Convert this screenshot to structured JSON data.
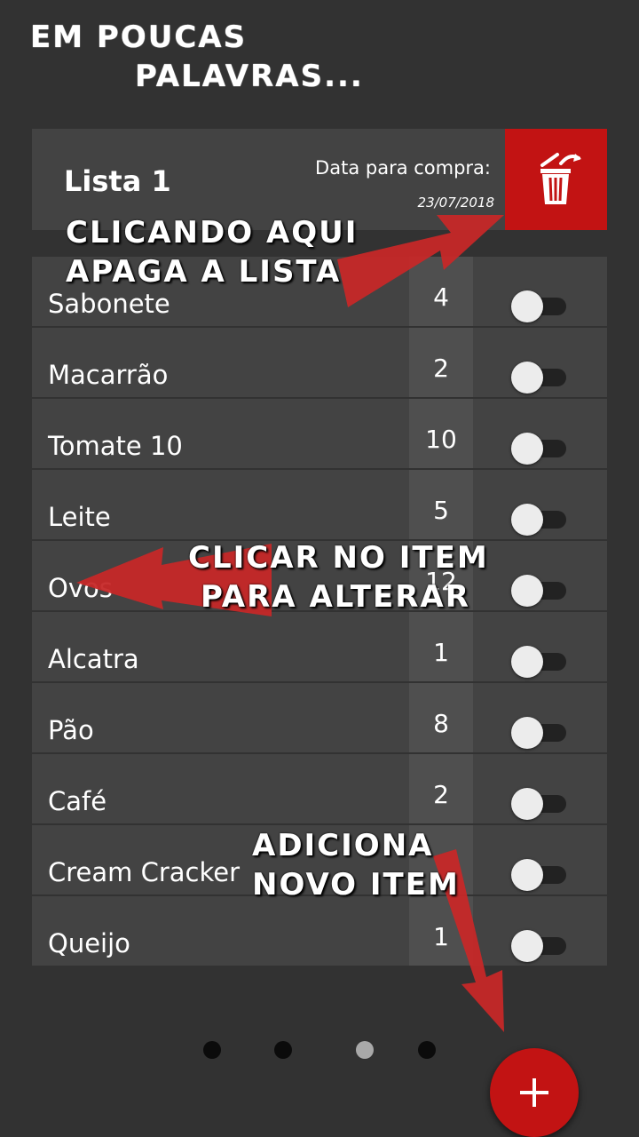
{
  "headline": {
    "line1": "EM POUCAS",
    "line2": "PALAVRAS..."
  },
  "list": {
    "title": "Lista 1",
    "date_label": "Data para compra:",
    "date_value": "23/07/2018"
  },
  "items": [
    {
      "name": "Sabonete",
      "qty": "4"
    },
    {
      "name": "Macarrão",
      "qty": "2"
    },
    {
      "name": "Tomate 10",
      "qty": "10"
    },
    {
      "name": "Leite",
      "qty": "5"
    },
    {
      "name": "Ovos",
      "qty": "12"
    },
    {
      "name": "Alcatra",
      "qty": "1"
    },
    {
      "name": "Pão",
      "qty": "8"
    },
    {
      "name": "Café",
      "qty": "2"
    },
    {
      "name": "Cream Cracker",
      "qty": ""
    },
    {
      "name": "Queijo",
      "qty": "1"
    }
  ],
  "annotations": {
    "delete_line1": "CLICANDO AQUI",
    "delete_line2": "APAGA A LISTA",
    "edit_line1": "CLICAR NO ITEM",
    "edit_line2": "PARA ALTERAR",
    "add_line1": "ADICIONA",
    "add_line2": "NOVO ITEM"
  },
  "icons": {
    "delete": "trash-icon",
    "add": "plus-icon"
  },
  "colors": {
    "accent": "#c21313",
    "background": "#323232",
    "card": "#434343",
    "annotation_arrow": "#c62828"
  },
  "pagination": {
    "count": 4,
    "active_index": 2
  }
}
